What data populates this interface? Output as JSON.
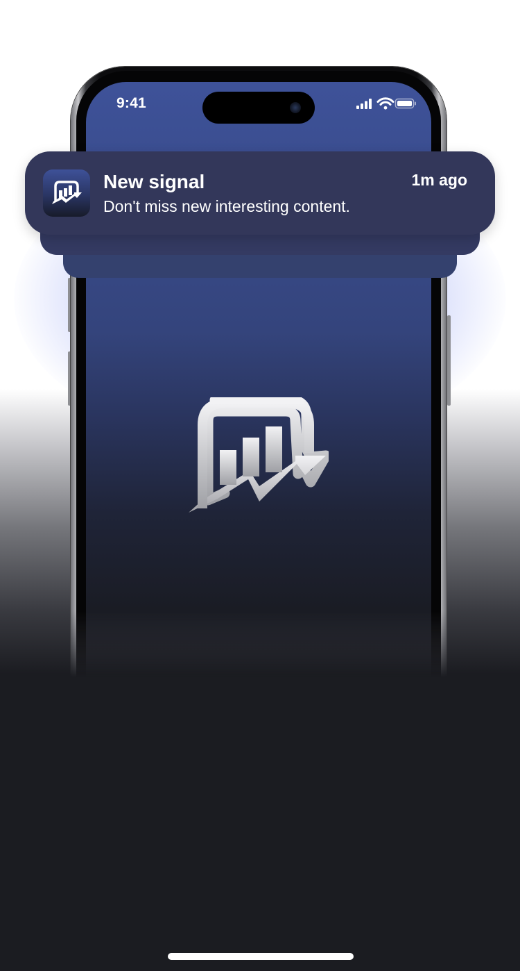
{
  "status_bar": {
    "time": "9:41",
    "icons": [
      "cellular-signal-icon",
      "wifi-icon",
      "battery-icon"
    ]
  },
  "notification": {
    "app_icon": "chart-chat-logo-icon",
    "title": "New signal",
    "time": "1m ago",
    "body": "Don't miss new interesting content."
  },
  "splash": {
    "logo": "chart-chat-logo-icon"
  },
  "colors": {
    "screen_top": "#3e5299",
    "screen_bottom": "#1a1b21",
    "notification_bg": "#33375a",
    "page_dark": "#1b1c21"
  }
}
